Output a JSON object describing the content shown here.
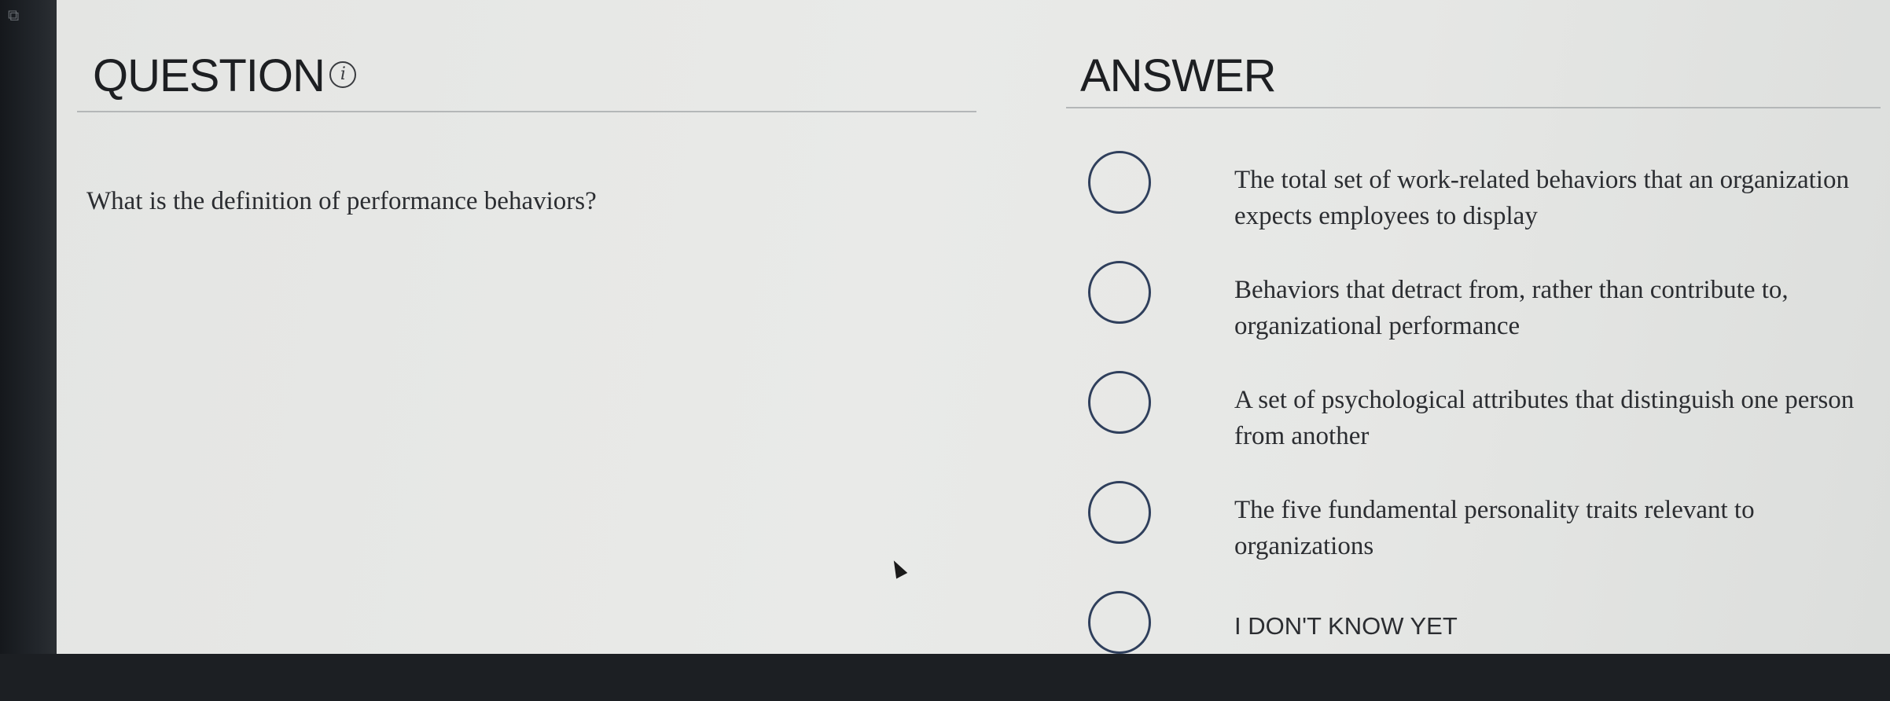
{
  "question": {
    "title": "QUESTION",
    "info_icon_glyph": "i",
    "text": "What is the definition of performance behaviors?"
  },
  "answer": {
    "title": "ANSWER",
    "options": [
      {
        "label": "The total set of work-related behaviors that an organization expects employees to display"
      },
      {
        "label": "Behaviors that detract from, rather than contribute to, organizational performance"
      },
      {
        "label": "A set of psychological attributes that distinguish one person from another"
      },
      {
        "label": "The five fundamental personality traits relevant to organizations"
      },
      {
        "label": "I DON'T KNOW YET"
      }
    ]
  },
  "colors": {
    "radio_border": "#2f3f5c",
    "text": "#2b2d31",
    "background": "#e8e9e7"
  },
  "icons": {
    "bezel": "copy-icon",
    "info": "info-icon",
    "pointer": "mouse-pointer-icon"
  }
}
